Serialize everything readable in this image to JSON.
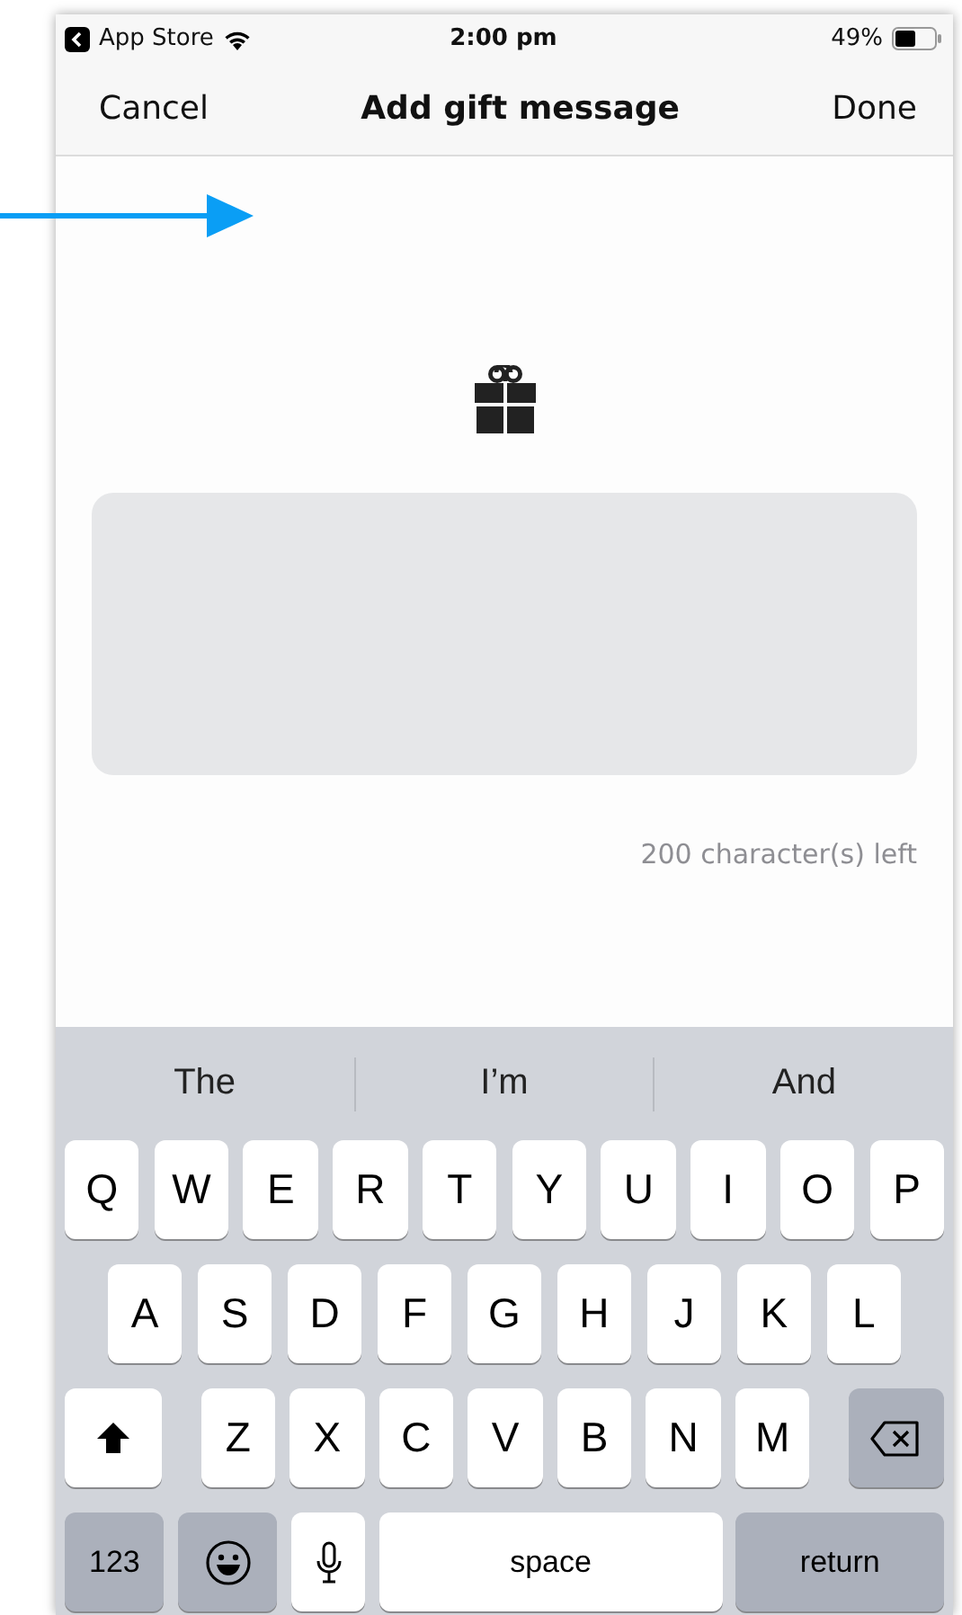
{
  "status_bar": {
    "back_app": "App Store",
    "time": "2:00 pm",
    "battery": "49%"
  },
  "nav": {
    "cancel": "Cancel",
    "title": "Add gift message",
    "done": "Done"
  },
  "message": {
    "counter": "200 character(s) left"
  },
  "suggestions": [
    "The",
    "I’m",
    "And"
  ],
  "keyboard": {
    "rows": [
      {
        "keys": [
          {
            "kind": "letter",
            "label": "Q"
          },
          {
            "kind": "letter",
            "label": "W"
          },
          {
            "kind": "letter",
            "label": "E"
          },
          {
            "kind": "letter",
            "label": "R"
          },
          {
            "kind": "letter",
            "label": "T"
          },
          {
            "kind": "letter",
            "label": "Y"
          },
          {
            "kind": "letter",
            "label": "U"
          },
          {
            "kind": "letter",
            "label": "I"
          },
          {
            "kind": "letter",
            "label": "O"
          },
          {
            "kind": "letter",
            "label": "P"
          }
        ]
      },
      {
        "keys": [
          {
            "kind": "letter",
            "label": "A"
          },
          {
            "kind": "letter",
            "label": "S"
          },
          {
            "kind": "letter",
            "label": "D"
          },
          {
            "kind": "letter",
            "label": "F"
          },
          {
            "kind": "letter",
            "label": "G"
          },
          {
            "kind": "letter",
            "label": "H"
          },
          {
            "kind": "letter",
            "label": "J"
          },
          {
            "kind": "letter",
            "label": "K"
          },
          {
            "kind": "letter",
            "label": "L"
          }
        ]
      },
      {
        "keys": [
          {
            "kind": "shift"
          },
          {
            "kind": "letter",
            "label": "Z"
          },
          {
            "kind": "letter",
            "label": "X"
          },
          {
            "kind": "letter",
            "label": "C"
          },
          {
            "kind": "letter",
            "label": "V"
          },
          {
            "kind": "letter",
            "label": "B"
          },
          {
            "kind": "letter",
            "label": "N"
          },
          {
            "kind": "letter",
            "label": "M"
          },
          {
            "kind": "delete"
          }
        ]
      },
      {
        "keys": [
          {
            "kind": "numbers",
            "label": "123"
          },
          {
            "kind": "emoji"
          },
          {
            "kind": "mic"
          },
          {
            "kind": "space",
            "label": "space"
          },
          {
            "kind": "return",
            "label": "return"
          }
        ]
      }
    ]
  }
}
